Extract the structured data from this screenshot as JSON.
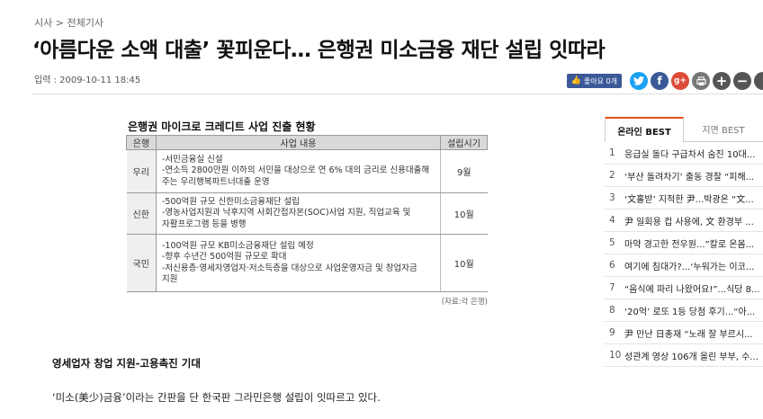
{
  "breadcrumb": {
    "section": "시사",
    "separator": ">",
    "category": "전체기사"
  },
  "article": {
    "headline": "‘아름다운 소액 대출’ 꽃피운다… 은행권 미소금융 재단 설립 잇따라",
    "meta": "입력 : 2009-10-11 18:45",
    "subheading": "영세업자 창업 지원-고용촉진 기대",
    "paragraph": "‘미소(美少)금융’이라는 간판을 단 한국판 그라민은행 설립이 잇따르고 있다."
  },
  "share": {
    "like_label": "좋아요 0개",
    "icons": [
      "twitter-icon",
      "facebook-icon",
      "google-plus-icon",
      "print-icon",
      "font-increase-icon",
      "font-decrease-icon"
    ],
    "colors": {
      "twitter": "#1da1f2",
      "facebook": "#3b5998",
      "googleplus": "#dd4b39"
    }
  },
  "figure": {
    "title": "은행권 마이크로 크레디트 사업 진출 현황",
    "headers": [
      "은행",
      "사업 내용",
      "설립시기"
    ],
    "rows": [
      {
        "bank": "우리",
        "lines": [
          "-서민금융실 신설",
          "-연소득 2800만원 이하의 서민을 대상으로 연 6% 대의 금리로 신용대출해",
          "주는 우리행복파트너대출 운영"
        ],
        "date": "9월"
      },
      {
        "bank": "신한",
        "lines": [
          "-500억원 규모 신한미소금융재단 설립",
          "-영농사업지원과 낙후지역 사회간접자본(SOC)사업 지원, 직업교육 및",
          "자활프로그램 등을 병행"
        ],
        "date": "10월"
      },
      {
        "bank": "국민",
        "lines": [
          "-100억원 규모 KB미소금융재단 설립 예정",
          "-향후 수년간 500억원 규모로 확대",
          "-저신용층·영세자영업자·저소득층을 대상으로 사업운영자금 및 창업자금",
          "지원"
        ],
        "date": "10월"
      }
    ],
    "source": "(자료:각 은행)"
  },
  "sidebar": {
    "tabs": [
      "온라인 BEST",
      "지면 BEST"
    ],
    "items": [
      {
        "rank": "1",
        "text": "응급실 돌다 구급차서 숨진 10대..."
      },
      {
        "rank": "2",
        "text": "‘부산 돌려차기’ 출동 경찰 “피해..."
      },
      {
        "rank": "3",
        "text": "‘文홀받’ 지적한 尹...박광온 “文..."
      },
      {
        "rank": "4",
        "text": "尹 일회용 컵 사용에, 文 환경부 ..."
      },
      {
        "rank": "5",
        "text": "마약 경고한 전우원...”칼로 온몸..."
      },
      {
        "rank": "6",
        "text": "여기에 침대가?...‘누워가는 이코..."
      },
      {
        "rank": "7",
        "text": "“음식에 파리 나왔어요!”...식당 8..."
      },
      {
        "rank": "8",
        "text": "‘20억’ 로또 1등 당첨 후기...“아..."
      },
      {
        "rank": "9",
        "text": "尹 만난 日총재 “노래 잘 부르시..."
      },
      {
        "rank": "10",
        "text": "성관계 영상 106개 올린 부부, 수..."
      }
    ]
  }
}
